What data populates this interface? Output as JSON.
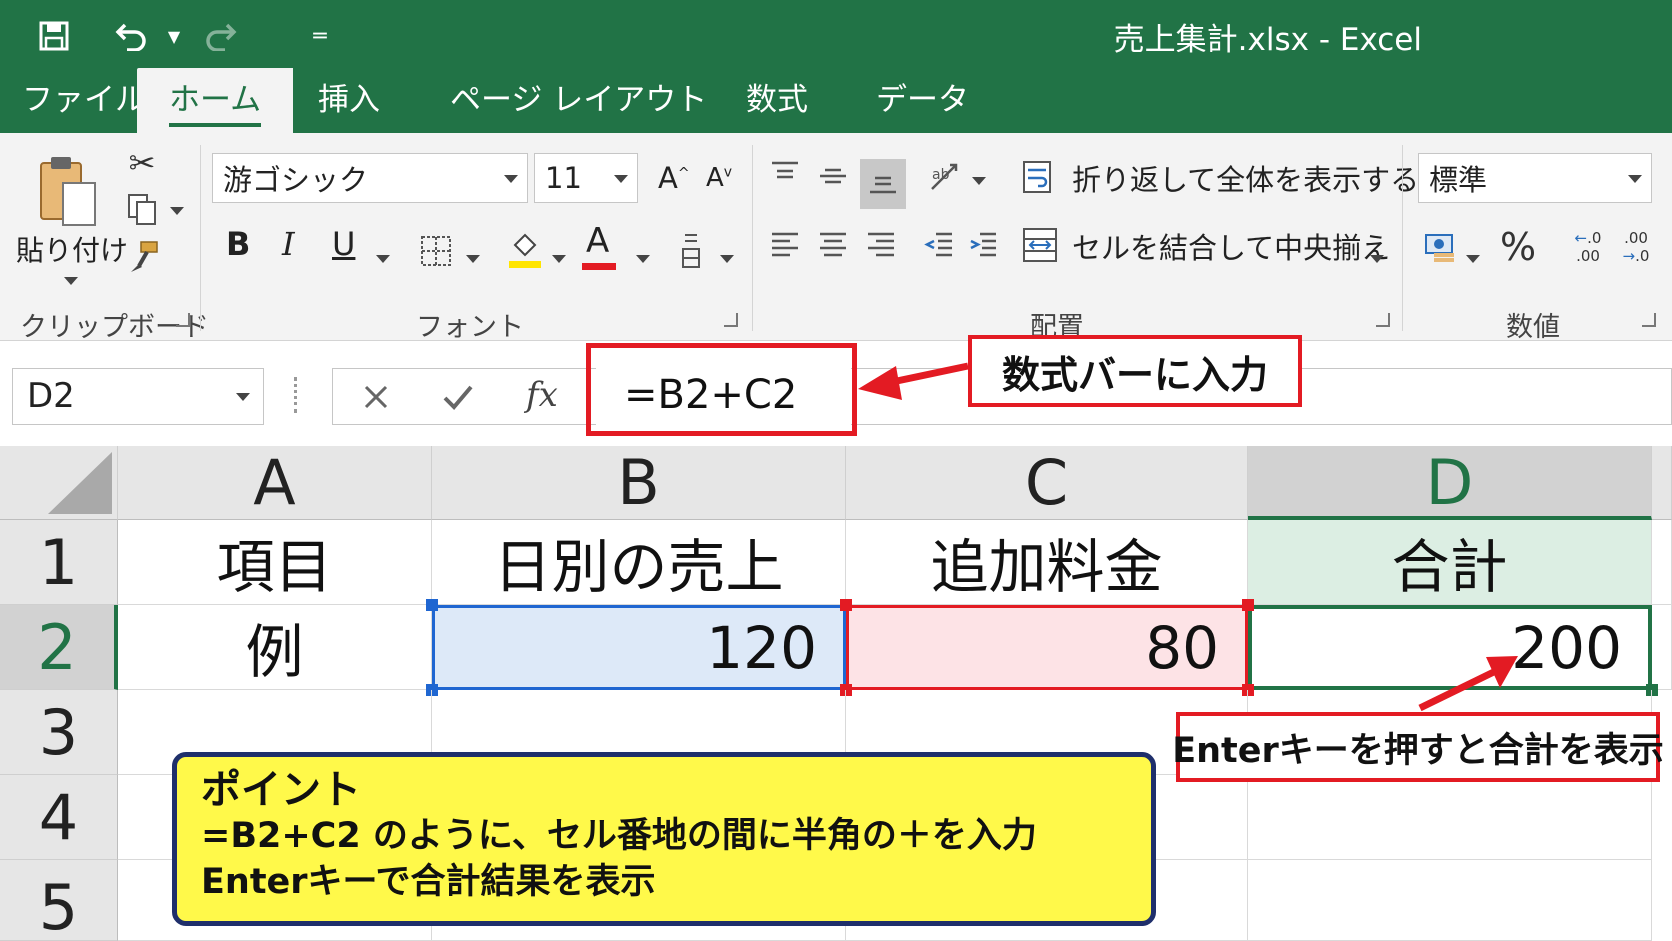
{
  "window": {
    "title": "売上集計.xlsx - Excel"
  },
  "quick_access": {
    "save_icon": "save-icon",
    "undo_icon": "undo-icon",
    "redo_icon": "redo-icon",
    "customize_icon": "customize-qat-icon"
  },
  "tabs": [
    {
      "label": "ファイル",
      "active": false
    },
    {
      "label": "ホーム",
      "active": true
    },
    {
      "label": "挿入",
      "active": false
    },
    {
      "label": "ページ レイアウト",
      "active": false
    },
    {
      "label": "数式",
      "active": false
    },
    {
      "label": "データ",
      "active": false
    }
  ],
  "ribbon": {
    "clipboard": {
      "paste_label": "貼り付け",
      "group_label": "クリップボード"
    },
    "font": {
      "name": "游ゴシック",
      "size": "11",
      "group_label": "フォント",
      "bold": "B",
      "italic": "I",
      "underline": "U",
      "font_color_glyph": "A",
      "grow_glyph": "A",
      "shrink_glyph": "A"
    },
    "alignment": {
      "wrap_label": "折り返して全体を表示する",
      "merge_label": "セルを結合して中央揃え",
      "group_label": "配置"
    },
    "number": {
      "format": "標準",
      "percent": "%",
      "group_label": "数値",
      "inc_decimal": ".00",
      "dec_decimal": ".0"
    }
  },
  "formula_bar": {
    "name_box": "D2",
    "fx": "fx",
    "formula": "=B2+C2",
    "callout": "数式バーに入力"
  },
  "sheet": {
    "columns": [
      "A",
      "B",
      "C",
      "D"
    ],
    "rows": [
      "1",
      "2",
      "3",
      "4",
      "5"
    ],
    "cells": {
      "A1": "項目",
      "B1": "日別の売上",
      "C1": "追加料金",
      "D1": "合計",
      "A2": "例",
      "B2": "120",
      "C2": "80",
      "D2": "200"
    },
    "active_cell": "D2"
  },
  "annotations": {
    "enter_callout": "Enterキーを押すと合計を表示",
    "point_title": "ポイント",
    "point_line1": "=B2+C2 のように、セル番地の間に半角の＋を入力",
    "point_line2": "Enterキーで合計結果を表示"
  },
  "colors": {
    "excel_green": "#217346",
    "callout_red": "#e31b23",
    "b_fill": "#dde9f8",
    "c_fill": "#fde3e6",
    "d_fill": "#dceee3",
    "point_bg": "#fff94a",
    "point_border": "#1f2f6b"
  }
}
